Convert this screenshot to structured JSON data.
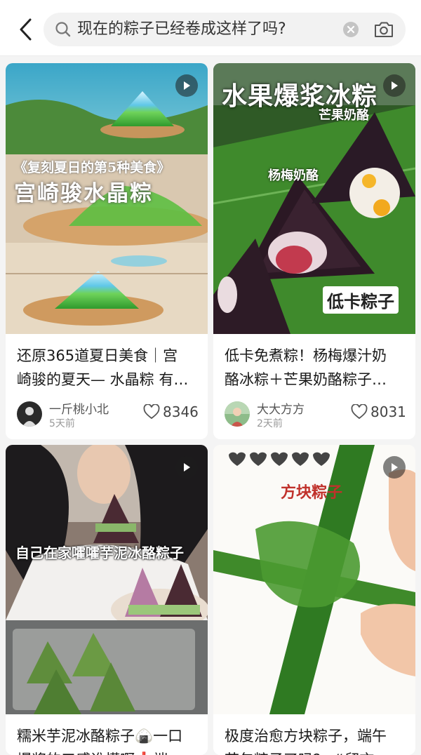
{
  "search": {
    "query": "现在的粽子已经卷成这样了吗?"
  },
  "cards": [
    {
      "overlay_sub": "《复刻夏日的第5种美食》",
      "overlay_main": "宫崎骏水晶粽",
      "title_line1": "还原365道夏日美食｜宫",
      "title_line2": "崎骏的夏天— 水晶粽 有…",
      "author": "一斤桃小北",
      "time": "5天前",
      "likes": "8346"
    },
    {
      "overlay_main": "水果爆浆冰粽",
      "label_mango": "芒果奶酪",
      "label_bayberry": "杨梅奶酪",
      "label_lowcal": "低卡粽子",
      "title_line1": "低卡免煮粽！杨梅爆汁奶",
      "title_line2": "酪冰粽＋芒果奶酪粽子…",
      "author": "大大方方",
      "time": "2天前",
      "likes": "8031"
    },
    {
      "overlay_main": "自己在家嚯嚯芋泥冰酪粽子",
      "title_line1": "糯米芋泥冰酪粽子🍙一口",
      "title_line2": "爆浆的口感谁懂啊❗️端"
    },
    {
      "overlay_main": "方块粽子",
      "title_line1": "极度治愈方块粽子，端午",
      "title_line2": "节包粽子了吗？ #留言"
    }
  ]
}
